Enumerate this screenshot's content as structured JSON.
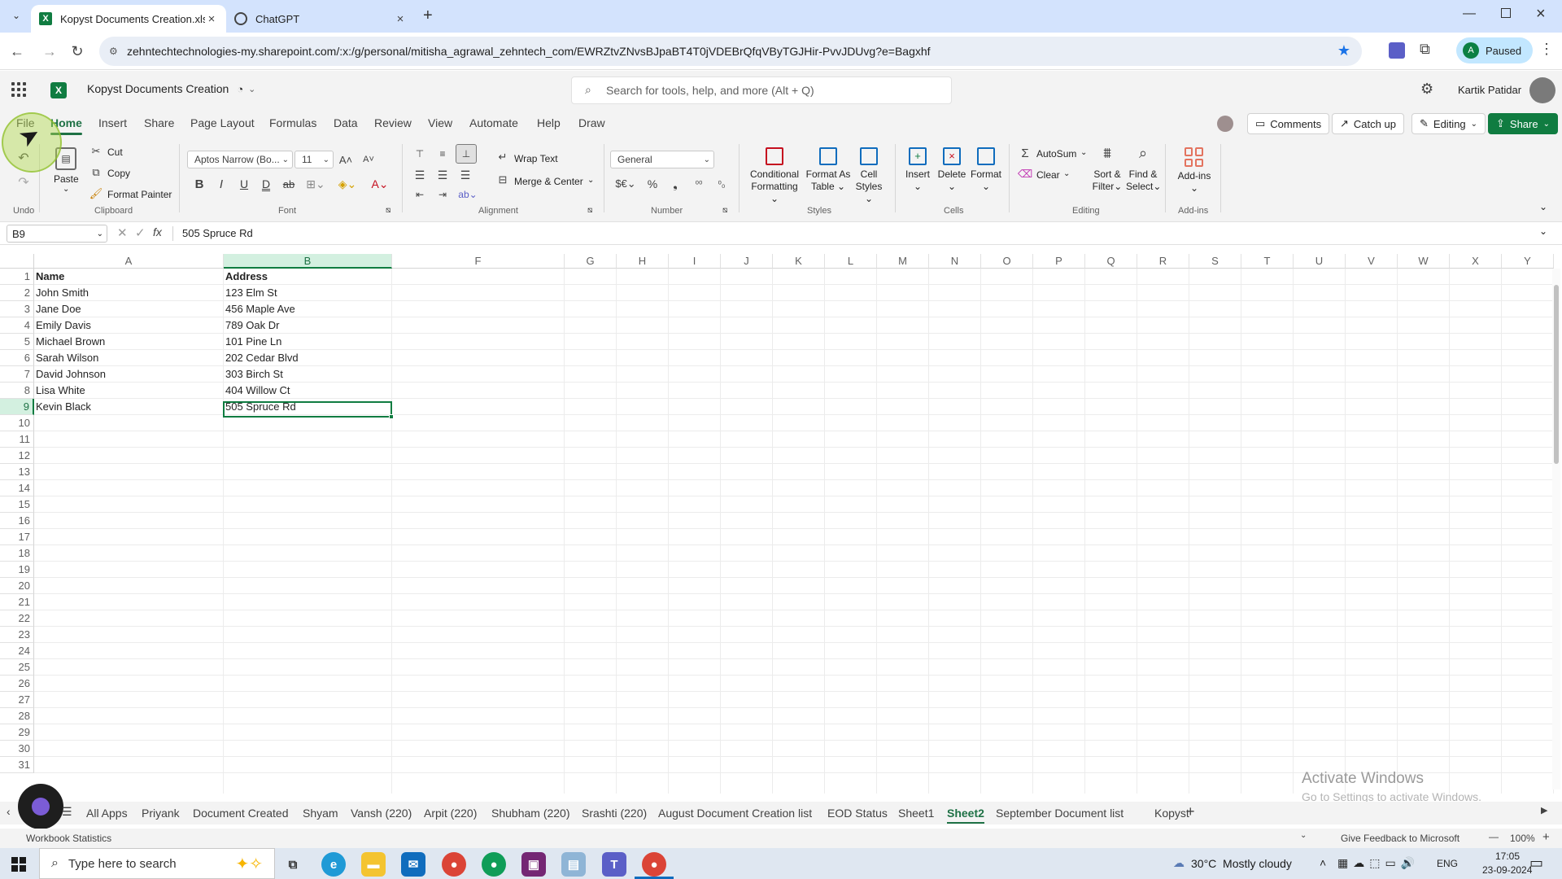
{
  "browser": {
    "tabs": [
      {
        "title": "Kopyst Documents Creation.xlsx",
        "active": true
      },
      {
        "title": "ChatGPT",
        "active": false
      }
    ],
    "url": "zehntechtechnologies-my.sharepoint.com/:x:/g/personal/mitisha_agrawal_zehntech_com/EWRZtvZNvsBJpaBT4T0jVDEBrQfqVByTGJHir-PvvJDUvg?e=Bagxhf",
    "profile_label": "Paused",
    "profile_initial": "A"
  },
  "app": {
    "doc_title": "Kopyst Documents Creation",
    "search_placeholder": "Search for tools, help, and more (Alt + Q)",
    "user_name": "Kartik Patidar"
  },
  "menu": {
    "items": [
      "File",
      "Home",
      "Insert",
      "Share",
      "Page Layout",
      "Formulas",
      "Data",
      "Review",
      "View",
      "Automate",
      "Help",
      "Draw"
    ],
    "comments_label": "Comments",
    "catchup_label": "Catch up",
    "editing_label": "Editing",
    "share_label": "Share"
  },
  "ribbon": {
    "undo_label": "Undo",
    "paste_label": "Paste",
    "cut_label": "Cut",
    "copy_label": "Copy",
    "format_painter_label": "Format Painter",
    "clipboard_label": "Clipboard",
    "font_name": "Aptos Narrow (Bo...",
    "font_size": "11",
    "font_label": "Font",
    "wrap_text_label": "Wrap Text",
    "merge_center_label": "Merge & Center",
    "alignment_label": "Alignment",
    "number_format": "General",
    "number_label": "Number",
    "conditional_formatting_label": [
      "Conditional",
      "Formatting"
    ],
    "format_as_table_label": [
      "Format As",
      "Table"
    ],
    "cell_styles_label": [
      "Cell",
      "Styles"
    ],
    "styles_label": "Styles",
    "insert_label": "Insert",
    "delete_label": "Delete",
    "format_label": "Format",
    "cells_label": "Cells",
    "autosum_label": "AutoSum",
    "clear_label": "Clear",
    "sort_filter_label": [
      "Sort &",
      "Filter"
    ],
    "find_select_label": [
      "Find &",
      "Select"
    ],
    "editing_label": "Editing",
    "addins_label": "Add-ins",
    "addins_group_label": "Add-ins"
  },
  "formula_bar": {
    "name_box": "B9",
    "formula": "505 Spruce Rd"
  },
  "grid": {
    "columns": [
      "A",
      "B",
      "F",
      "G",
      "H",
      "I",
      "J",
      "K",
      "L",
      "M",
      "N",
      "O",
      "P",
      "Q",
      "R",
      "S",
      "T",
      "U",
      "V",
      "W",
      "X",
      "Y"
    ],
    "row_numbers": [
      "1",
      "2",
      "3",
      "4",
      "5",
      "6",
      "7",
      "8",
      "9",
      "10",
      "11",
      "12",
      "13",
      "14",
      "15",
      "16",
      "17",
      "18",
      "19",
      "20",
      "21",
      "22",
      "23",
      "24",
      "25",
      "26",
      "27",
      "28",
      "29",
      "30",
      "31"
    ],
    "rows": [
      [
        "Name",
        "Address"
      ],
      [
        "John Smith",
        "123 Elm St"
      ],
      [
        "Jane Doe",
        "456 Maple Ave"
      ],
      [
        "Emily Davis",
        "789 Oak Dr"
      ],
      [
        "Michael Brown",
        "101 Pine Ln"
      ],
      [
        "Sarah Wilson",
        "202 Cedar Blvd"
      ],
      [
        "David Johnson",
        "303 Birch St"
      ],
      [
        "Lisa White",
        "404 Willow Ct"
      ],
      [
        "Kevin Black",
        "505 Spruce Rd"
      ]
    ],
    "selected_cell": "B9"
  },
  "sheets": {
    "tabs": [
      "All Apps",
      "Priyank",
      "Document Created",
      "Shyam",
      "Vansh (220)",
      "Arpit (220)",
      "Shubham (220)",
      "Srashti (220)",
      "August Document Creation list",
      "EOD Status",
      "Sheet1",
      "Sheet2",
      "September Document list",
      "Kopyst"
    ],
    "active": "Sheet2"
  },
  "status": {
    "left": "Workbook Statistics",
    "feedback": "Give Feedback to Microsoft",
    "zoom": "100%"
  },
  "watermark": {
    "line1": "Activate Windows",
    "line2": "Go to Settings to activate Windows."
  },
  "taskbar": {
    "search_placeholder": "Type here to search",
    "weather": "30°C  Mostly cloudy",
    "lang": "ENG",
    "time": "17:05",
    "date": "23-09-2024"
  },
  "colors": {
    "excel_green": "#1e7145",
    "share_green": "#107c41",
    "browser_tab_bg": "#d3e3fd",
    "selection_border": "#107c41"
  }
}
